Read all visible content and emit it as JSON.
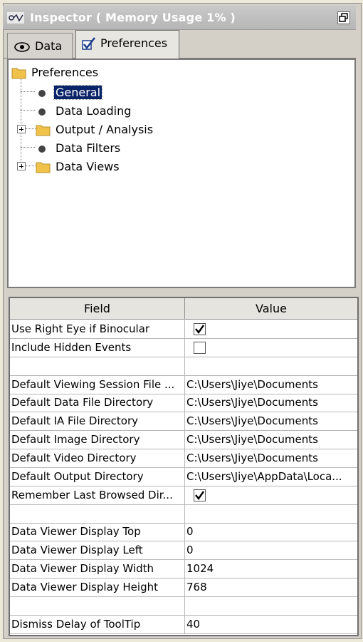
{
  "window": {
    "title": "Inspector ( Memory Usage 1% )"
  },
  "tabs": [
    {
      "label": "Data",
      "icon": "eye-icon",
      "active": false
    },
    {
      "label": "Preferences",
      "icon": "checkmark-icon",
      "active": true
    }
  ],
  "tree": {
    "root": "Preferences",
    "items": [
      {
        "label": "General",
        "type": "leaf",
        "selected": true
      },
      {
        "label": "Data Loading",
        "type": "leaf",
        "selected": false
      },
      {
        "label": "Output / Analysis",
        "type": "folder",
        "selected": false
      },
      {
        "label": "Data Filters",
        "type": "leaf",
        "selected": false
      },
      {
        "label": "Data Views",
        "type": "folder",
        "selected": false
      }
    ]
  },
  "grid": {
    "columns": [
      "Field",
      "Value"
    ],
    "rows": [
      {
        "field": "Use Right Eye if Binocular",
        "value": "",
        "checkbox": true,
        "checked": true
      },
      {
        "field": "Include Hidden Events",
        "value": "",
        "checkbox": true,
        "checked": false
      },
      {
        "field": "",
        "value": ""
      },
      {
        "field": "Default Viewing Session File ...",
        "value": "C:\\Users\\Jiye\\Documents"
      },
      {
        "field": "Default Data File Directory",
        "value": "C:\\Users\\Jiye\\Documents"
      },
      {
        "field": "Default IA File Directory",
        "value": "C:\\Users\\Jiye\\Documents"
      },
      {
        "field": "Default Image Directory",
        "value": "C:\\Users\\Jiye\\Documents"
      },
      {
        "field": "Default Video Directory",
        "value": "C:\\Users\\Jiye\\Documents"
      },
      {
        "field": "Default Output Directory",
        "value": "C:\\Users\\Jiye\\AppData\\Loca..."
      },
      {
        "field": "Remember Last Browsed Dir...",
        "value": "",
        "checkbox": true,
        "checked": true
      },
      {
        "field": "",
        "value": ""
      },
      {
        "field": "Data Viewer Display Top",
        "value": "0"
      },
      {
        "field": "Data Viewer Display Left",
        "value": "0"
      },
      {
        "field": "Data Viewer Display Width",
        "value": "1024"
      },
      {
        "field": "Data Viewer Display Height",
        "value": "768"
      },
      {
        "field": "",
        "value": ""
      },
      {
        "field": "Dismiss Delay of ToolTip",
        "value": "40"
      }
    ]
  }
}
